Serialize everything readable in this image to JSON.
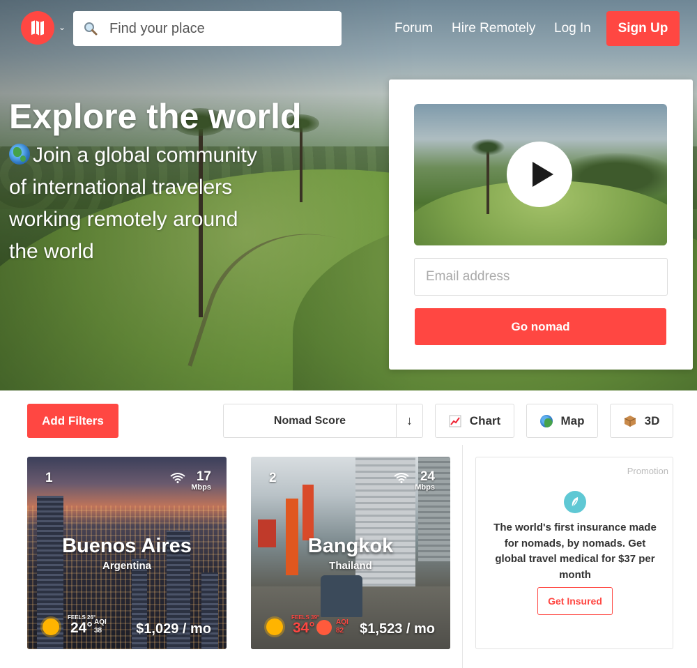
{
  "header": {
    "search_placeholder": "Find your place",
    "nav": [
      "Forum",
      "Hire Remotely",
      "Log In"
    ],
    "signup_label": "Sign Up"
  },
  "hero": {
    "title": "Explore the world",
    "subtitle": "Join a global community of international travelers working remotely around the world"
  },
  "signup_card": {
    "email_placeholder": "Email address",
    "cta_label": "Go nomad"
  },
  "toolbar": {
    "filters_label": "Add Filters",
    "sort_label": "Nomad Score",
    "sort_arrow": "↓",
    "views": [
      {
        "label": "Chart",
        "icon": "chart-icon"
      },
      {
        "label": "Map",
        "icon": "globe-icon"
      },
      {
        "label": "3D",
        "icon": "box-icon"
      }
    ]
  },
  "cities": [
    {
      "rank": "1",
      "wifi": "17",
      "wifi_unit": "Mbps",
      "name": "Buenos Aires",
      "country": "Argentina",
      "feels": "FEELS 26°",
      "temp": "24°",
      "aqi_label": "AQI",
      "aqi": "38",
      "cost": "$1,029 / mo"
    },
    {
      "rank": "2",
      "wifi": "24",
      "wifi_unit": "Mbps",
      "name": "Bangkok",
      "country": "Thailand",
      "feels": "FEELS 39°",
      "temp": "34°",
      "aqi_label": "AQI",
      "aqi": "82",
      "cost": "$1,523 / mo"
    }
  ],
  "promo": {
    "tag": "Promotion",
    "text": "The world's first insurance made for nomads, by nomads. Get global travel medical for $37 per month",
    "button_label": "Get Insured"
  },
  "colors": {
    "accent": "#ff4742",
    "promo_icon": "#5fc8d4"
  }
}
